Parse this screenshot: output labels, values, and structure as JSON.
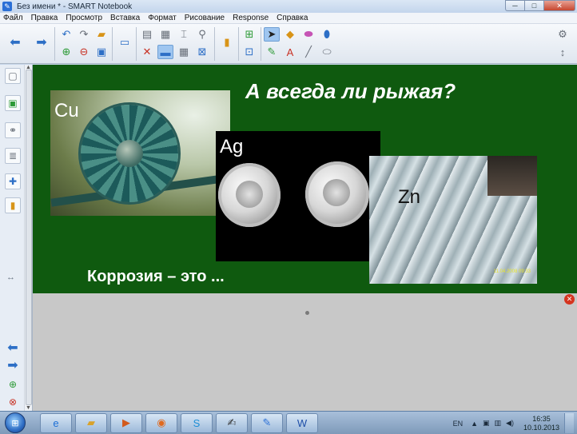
{
  "window": {
    "title": "Без имени * - SMART Notebook",
    "minimize": "─",
    "maximize": "□",
    "close": "✕"
  },
  "menu": {
    "items": [
      "Файл",
      "Правка",
      "Просмотр",
      "Вставка",
      "Формат",
      "Рисование",
      "Response",
      "Справка"
    ]
  },
  "slide": {
    "title": "А всегда ли рыжая?",
    "subtitle": "Коррозия – это ...",
    "photos": [
      {
        "label": "Cu"
      },
      {
        "label": "Ag"
      },
      {
        "label": "Zn",
        "date_stamp": "11.04.2008 09:33"
      }
    ]
  },
  "taskbar": {
    "tray_lang": "EN",
    "time": "16:35",
    "date": "10.10.2013"
  },
  "colors": {
    "slide_background": "#0f5a0f",
    "canvas_gray": "#c8c8c8",
    "accent_blue": "#2d6fc6"
  }
}
